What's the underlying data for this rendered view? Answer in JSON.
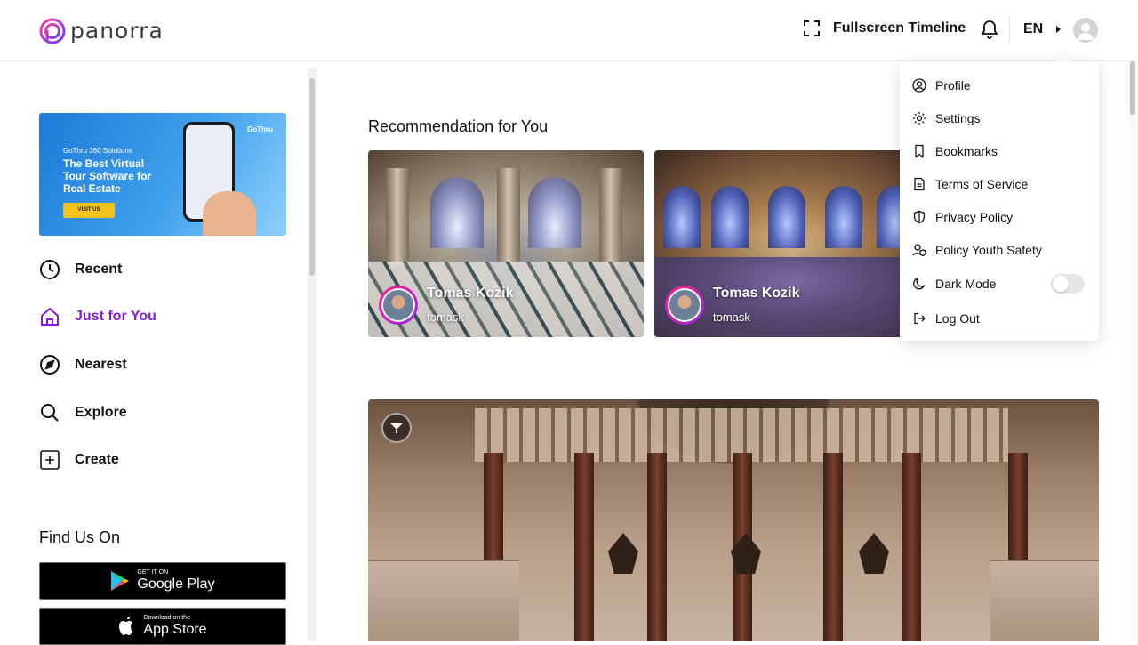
{
  "brand": {
    "name": "panorra",
    "accent": "#8a1bd6",
    "accent_pink": "#ff1f8f"
  },
  "header": {
    "fullscreen_label": "Fullscreen Timeline",
    "language": "EN",
    "icons": [
      "fullscreen-icon",
      "bell-icon",
      "caret-right-icon",
      "avatar"
    ]
  },
  "promo": {
    "small": "GoThru 360 Solutions",
    "title": "The Best Virtual Tour Software for Real Estate",
    "button": "VISIT US",
    "brand": "GoThru"
  },
  "nav": {
    "items": [
      {
        "label": "Recent",
        "icon": "clock-icon",
        "active": false
      },
      {
        "label": "Just for You",
        "icon": "home-icon",
        "active": true
      },
      {
        "label": "Nearest",
        "icon": "compass-icon",
        "active": false
      },
      {
        "label": "Explore",
        "icon": "search-icon",
        "active": false
      },
      {
        "label": "Create",
        "icon": "plus-square-icon",
        "active": false
      }
    ]
  },
  "find_us": {
    "title": "Find Us On",
    "google": {
      "small": "GET IT ON",
      "big": "Google Play"
    },
    "apple": {
      "small": "Download on the",
      "big": "App Store"
    }
  },
  "main": {
    "section_title": "Recommendation for You",
    "cards": [
      {
        "name": "Tomas Kozik",
        "username": "tomask"
      },
      {
        "name": "Tomas Kozik",
        "username": "tomask"
      }
    ]
  },
  "dropdown": {
    "items": [
      {
        "label": "Profile",
        "icon": "user-circle-icon"
      },
      {
        "label": "Settings",
        "icon": "gear-icon"
      },
      {
        "label": "Bookmarks",
        "icon": "bookmark-icon"
      },
      {
        "label": "Terms of Service",
        "icon": "document-icon"
      },
      {
        "label": "Privacy Policy",
        "icon": "shield-icon"
      },
      {
        "label": "Policy Youth Safety",
        "icon": "user-shield-icon"
      },
      {
        "label": "Dark Mode",
        "icon": "moon-icon"
      },
      {
        "label": "Log Out",
        "icon": "logout-icon"
      }
    ],
    "dark_mode_on": false
  }
}
